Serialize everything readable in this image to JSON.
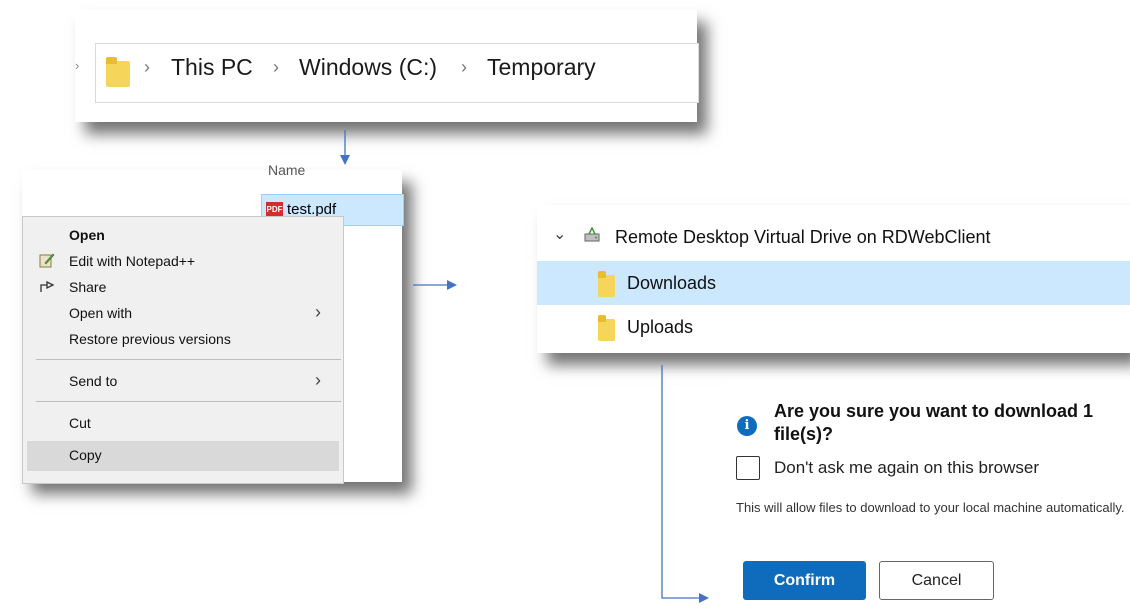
{
  "breadcrumb": {
    "items": [
      "This PC",
      "Windows (C:)",
      "Temporary"
    ],
    "separator": "›"
  },
  "explorer": {
    "column_header": "Name",
    "file": {
      "name": "test.pdf",
      "icon": "pdf-icon",
      "badge": "PDF"
    }
  },
  "context_menu": {
    "items": [
      {
        "label": "Open",
        "bold": true
      },
      {
        "label": "Edit with Notepad++",
        "icon": "notepad-icon"
      },
      {
        "label": "Share",
        "icon": "share-icon"
      },
      {
        "label": "Open with",
        "submenu": true
      },
      {
        "label": "Restore previous versions"
      },
      {
        "label": "Send to",
        "submenu": true
      },
      {
        "label": "Cut"
      },
      {
        "label": "Copy",
        "selected": true
      }
    ]
  },
  "remote_drive": {
    "root_label": "Remote Desktop Virtual Drive on RDWebClient",
    "folders": [
      {
        "label": "Downloads",
        "selected": true
      },
      {
        "label": "Uploads",
        "selected": false
      }
    ]
  },
  "download_dialog": {
    "title": "Are you sure you want to download 1 file(s)?",
    "checkbox_label": "Don't ask me again on this browser",
    "checkbox_checked": false,
    "description": "This will allow files to download to your local machine automatically.",
    "confirm_label": "Confirm",
    "cancel_label": "Cancel"
  },
  "colors": {
    "accent": "#0f6cbd",
    "selection": "#cce8ff",
    "folder": "#f6d65a",
    "arrow": "#4472c4"
  }
}
